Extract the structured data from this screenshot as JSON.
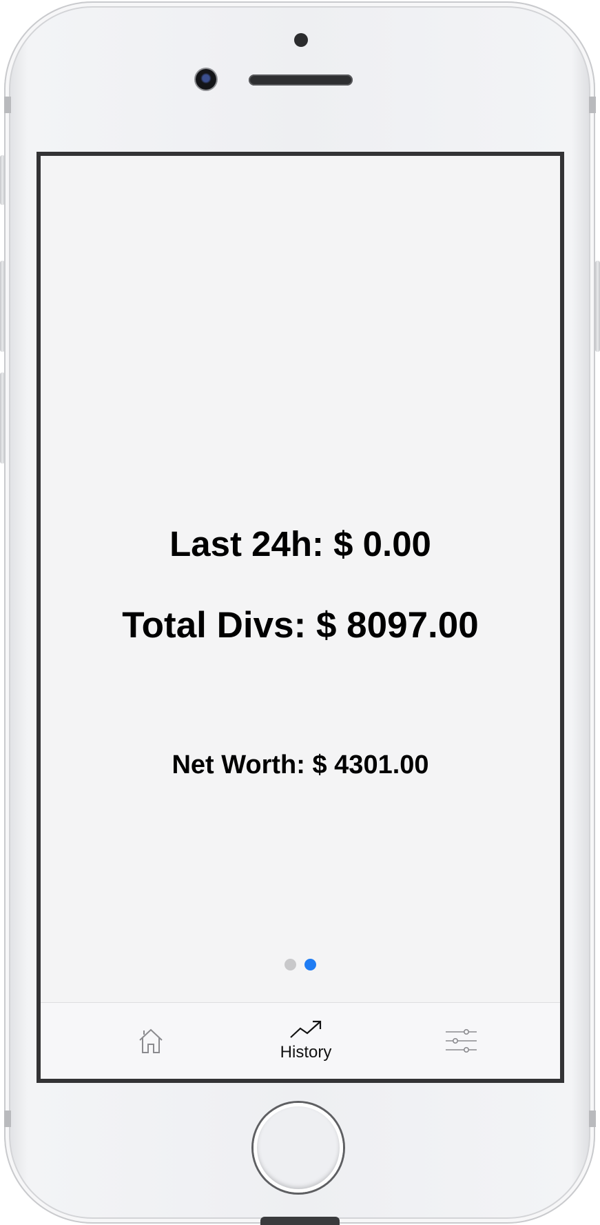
{
  "screen": {
    "last_24h": "Last 24h: $ 0.00",
    "total_divs": "Total Divs: $ 8097.00",
    "net_worth": "Net Worth: $ 4301.00"
  },
  "pager": {
    "page_count": 2,
    "active_page": 2,
    "active_color": "#1f7cf3",
    "inactive_color": "#c8c8ca"
  },
  "tabbar": {
    "tabs": [
      {
        "icon": "home-icon",
        "label": ""
      },
      {
        "icon": "trending-up-icon",
        "label": "History"
      },
      {
        "icon": "sliders-icon",
        "label": ""
      }
    ]
  }
}
